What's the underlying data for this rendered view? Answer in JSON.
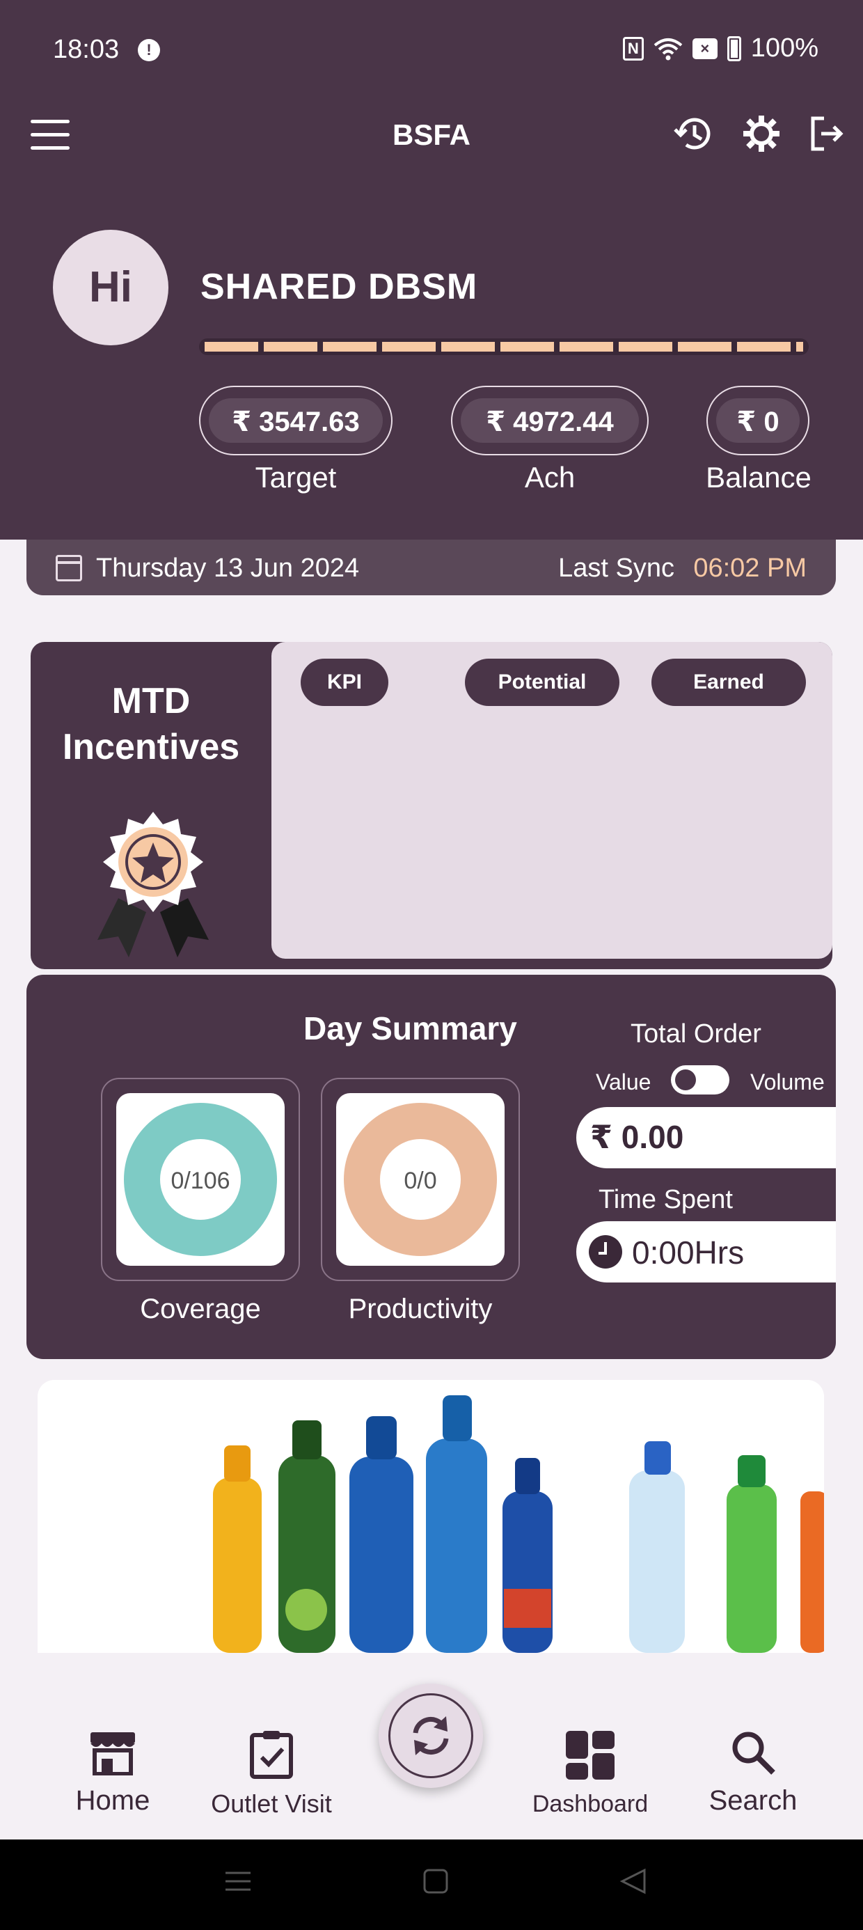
{
  "status_bar": {
    "time": "18:03",
    "nfc": "N",
    "battery": "100%",
    "icons": [
      "info-icon",
      "nfc-icon",
      "wifi-icon",
      "no-sim-icon",
      "battery-icon"
    ]
  },
  "app_bar": {
    "title": "BSFA",
    "icons": [
      "menu-icon",
      "history-icon",
      "settings-icon",
      "logout-icon"
    ]
  },
  "profile": {
    "avatar_text": "Hi",
    "name": "SHARED DBSM",
    "stats": [
      {
        "value": "₹ 3547.63",
        "label": "Target"
      },
      {
        "value": "₹ 4972.44",
        "label": "Ach"
      },
      {
        "value": "₹ 0",
        "label": "Balance"
      }
    ]
  },
  "date_bar": {
    "date": "Thursday 13 Jun 2024",
    "last_sync_label": "Last Sync",
    "last_sync_time": "06:02 PM"
  },
  "mtd_incentives": {
    "title_line1": "MTD",
    "title_line2": "Incentives",
    "chips": [
      "KPI",
      "Potential",
      "Earned"
    ]
  },
  "day_summary": {
    "title": "Day Summary",
    "coverage": {
      "value": "0/106",
      "label": "Coverage"
    },
    "productivity": {
      "value": "0/0",
      "label": "Productivity"
    },
    "total_order_label": "Total Order",
    "toggle_left": "Value",
    "toggle_right": "Volume",
    "order_value": "₹ 0.00",
    "time_spent_label": "Time Spent",
    "time_spent_value": "0:00Hrs"
  },
  "colors": {
    "primary": "#4a3548",
    "accent": "#f7c9a4",
    "coverage": "#7ecbc5",
    "productivity": "#eab99a"
  },
  "bottom_nav": {
    "home": "Home",
    "outlet_visit": "Outlet Visit",
    "dashboard": "Dashboard",
    "search": "Search"
  }
}
